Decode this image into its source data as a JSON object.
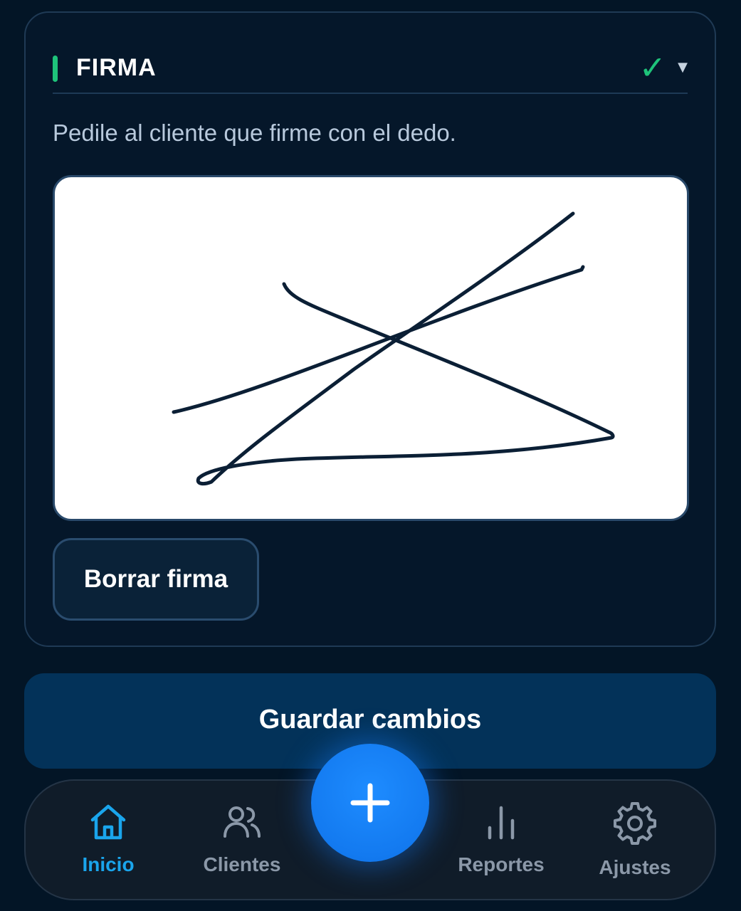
{
  "card": {
    "title": "FIRMA",
    "status_icon": "check-icon",
    "expand_icon": "chevron-down-icon",
    "instruction": "Pedile al cliente que firme con el dedo.",
    "clear_button": "Borrar firma",
    "accent_color": "#1ec37a"
  },
  "actions": {
    "save_label": "Guardar cambios"
  },
  "nav": {
    "items": [
      {
        "label": "Inicio",
        "icon": "home-icon",
        "active": true
      },
      {
        "label": "Clientes",
        "icon": "users-icon",
        "active": false
      },
      {
        "label": "Reportes",
        "icon": "bar-chart-icon",
        "active": false
      },
      {
        "label": "Ajustes",
        "icon": "gear-icon",
        "active": false
      }
    ],
    "fab_icon": "plus-icon",
    "active_color": "#1aa5ec",
    "inactive_color": "#8b98a8"
  }
}
